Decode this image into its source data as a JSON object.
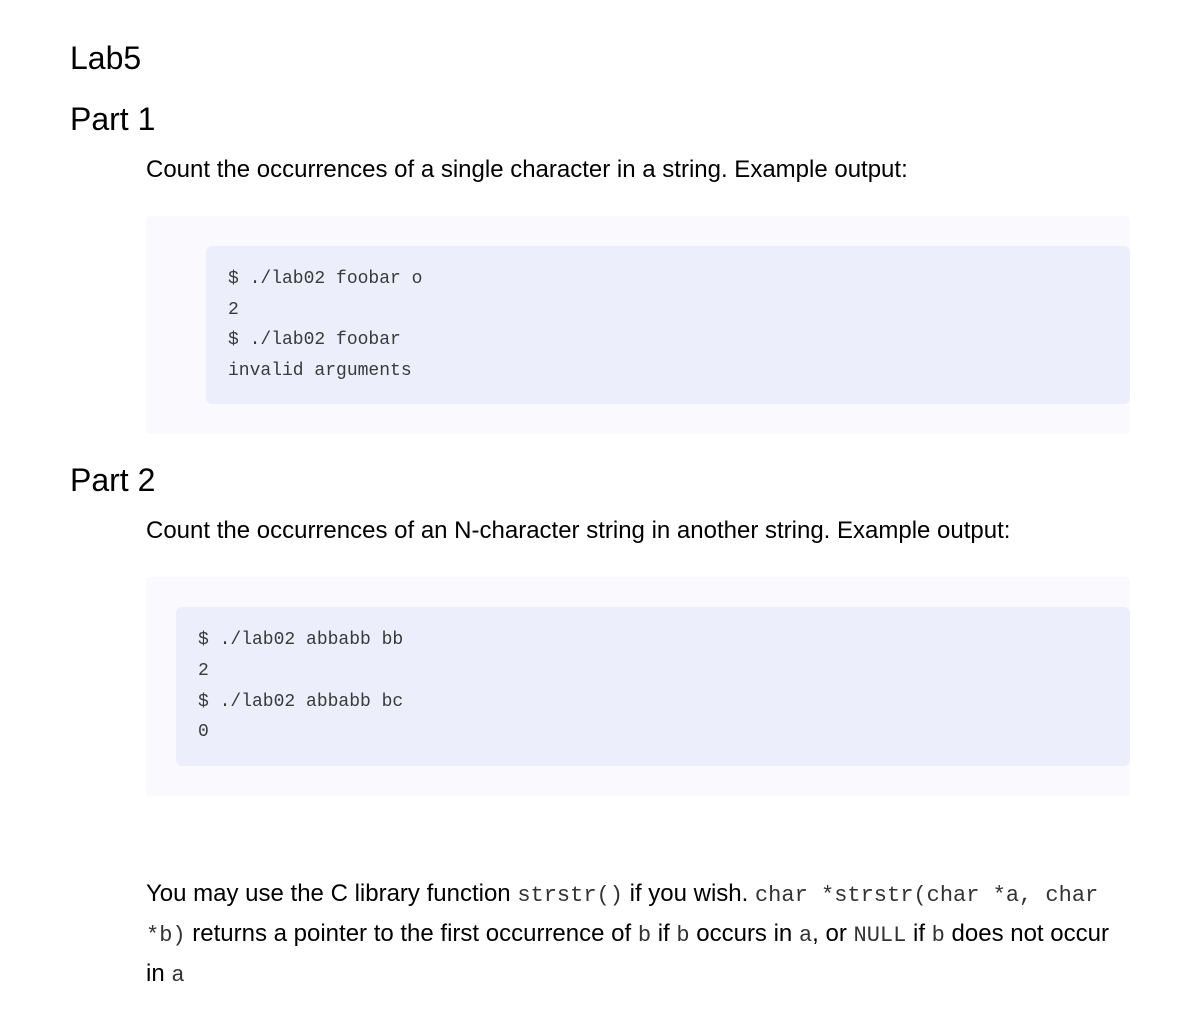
{
  "title": "Lab5",
  "part1": {
    "heading": "Part 1",
    "description": "Count the occurrences of a single character in a string. Example output:",
    "code": "$ ./lab02 foobar o\n2\n$ ./lab02 foobar\ninvalid arguments"
  },
  "part2": {
    "heading": "Part 2",
    "description": "Count the occurrences of an N-character string in another string. Example output:",
    "code": "$ ./lab02 abbabb bb\n2\n$ ./lab02 abbabb bc\n0"
  },
  "hint": {
    "prefix": "You may use the C library function ",
    "code1": "strstr()",
    "mid1": " if you wish. ",
    "code2": "char *strstr(char *a, char *b)",
    "mid2": " returns a pointer to the first occurrence of ",
    "code3": "b",
    "mid3": " if ",
    "code4": "b",
    "mid4": " occurs in ",
    "code5": "a",
    "mid5": ", or ",
    "code6": "NULL",
    "mid6": " if ",
    "code7": "b",
    "mid7": " does not occur in ",
    "code8": "a"
  }
}
